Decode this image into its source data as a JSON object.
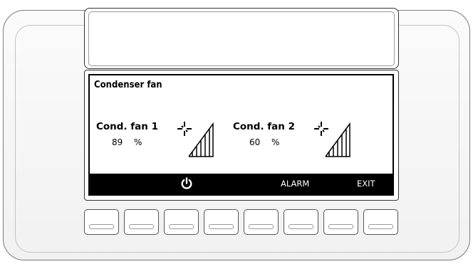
{
  "screen": {
    "title": "Condenser fan",
    "fans": [
      {
        "label": "Cond. fan 1",
        "value": "89",
        "unit": "%"
      },
      {
        "label": "Cond. fan 2",
        "value": "60",
        "unit": "%"
      }
    ]
  },
  "statusbar": {
    "power_icon": "power-icon",
    "alarm_label": "ALARM",
    "exit_label": "EXIT"
  },
  "keypad": {
    "key_count": 8
  },
  "icons": {
    "fan": "fan-icon",
    "speed_bars": "signal-bars-icon"
  },
  "colors": {
    "screen_bg": "#ffffff",
    "ink": "#000000",
    "bezel": "#f4f4f4"
  }
}
